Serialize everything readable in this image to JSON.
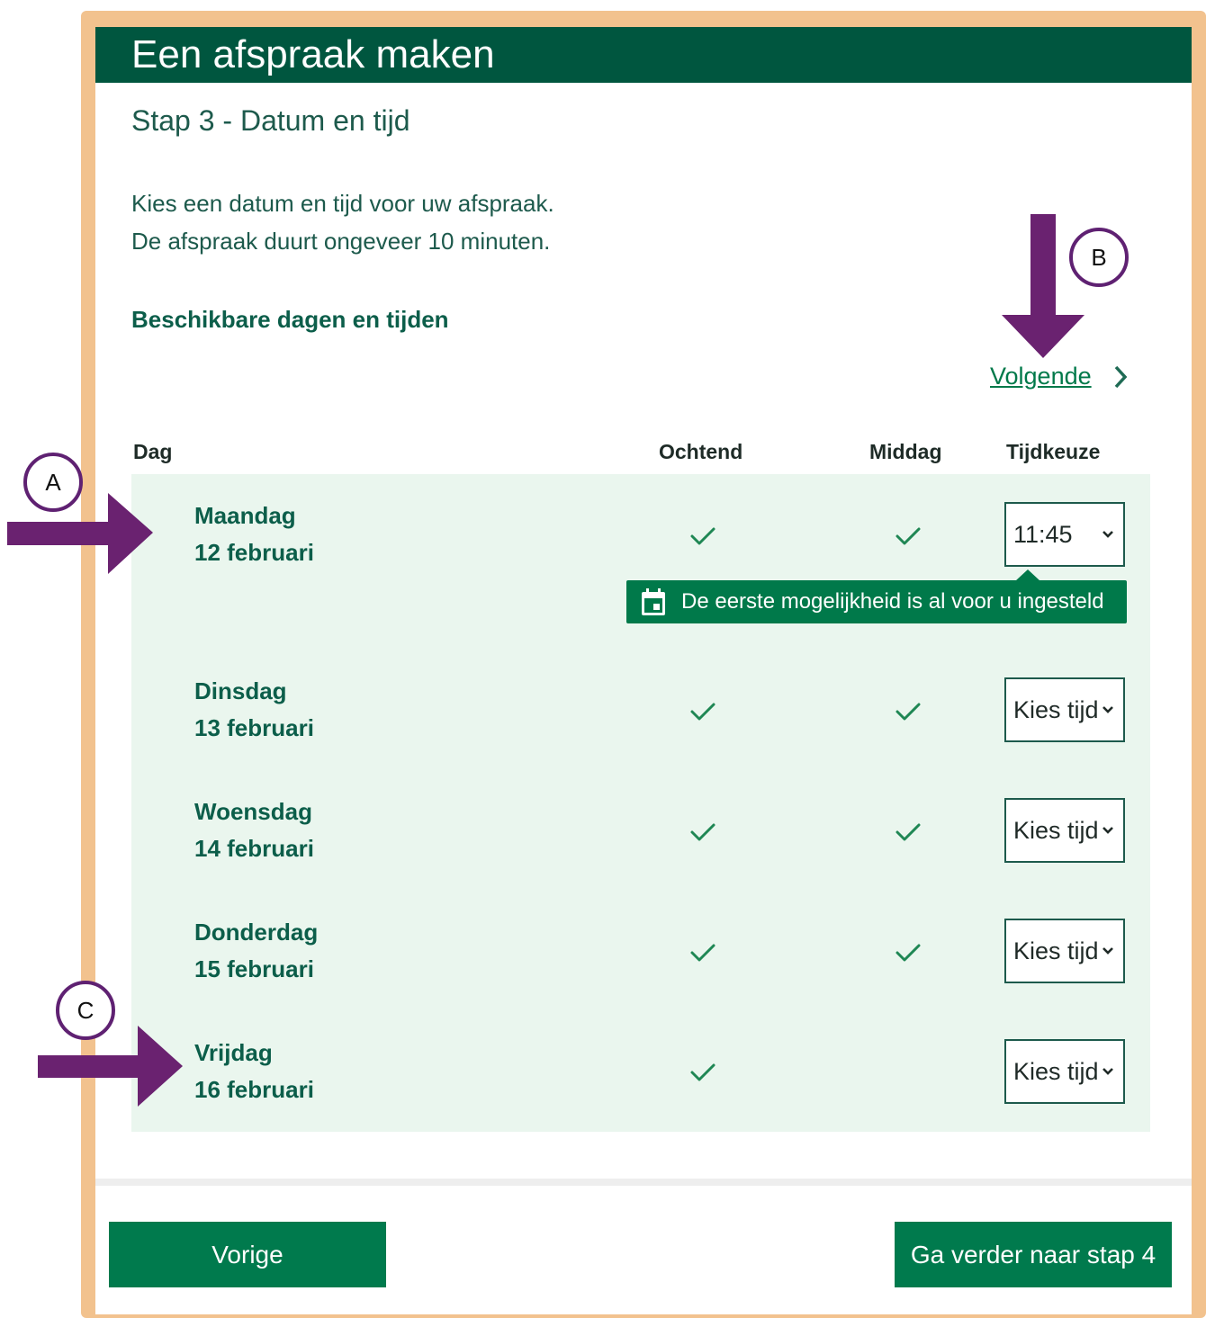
{
  "header": {
    "title": "Een afspraak maken"
  },
  "step_title": "Stap 3 - Datum en tijd",
  "intro": {
    "line1": "Kies een datum en tijd voor uw afspraak.",
    "line2": "De afspraak duurt ongeveer 10 minuten."
  },
  "section_title": "Beschikbare dagen en tijden",
  "next_link": "Volgende",
  "table": {
    "headers": {
      "day": "Dag",
      "morning": "Ochtend",
      "afternoon": "Middag",
      "time": "Tijdkeuze"
    },
    "rows": [
      {
        "day": "Maandag",
        "date": "12 februari",
        "morning": true,
        "afternoon": true,
        "selected_time": "11:45"
      },
      {
        "day": "Dinsdag",
        "date": "13 februari",
        "morning": true,
        "afternoon": true,
        "selected_time": "Kies tijd"
      },
      {
        "day": "Woensdag",
        "date": "14 februari",
        "morning": true,
        "afternoon": true,
        "selected_time": "Kies tijd"
      },
      {
        "day": "Donderdag",
        "date": "15 februari",
        "morning": true,
        "afternoon": true,
        "selected_time": "Kies tijd"
      },
      {
        "day": "Vrijdag",
        "date": "16 februari",
        "morning": true,
        "afternoon": false,
        "selected_time": "Kies tijd"
      }
    ]
  },
  "tooltip": {
    "text": "De eerste mogelijkheid is al voor u ingesteld",
    "icon": "calendar-icon"
  },
  "buttons": {
    "previous": "Vorige",
    "continue": "Ga verder naar stap 4"
  },
  "annotations": {
    "a": "A",
    "b": "B",
    "c": "C"
  },
  "colors": {
    "header": "#00563f",
    "primary": "#007a4d",
    "row_bg": "#eaf6ee",
    "frame": "#f2c28e",
    "arrow": "#6a2270"
  }
}
